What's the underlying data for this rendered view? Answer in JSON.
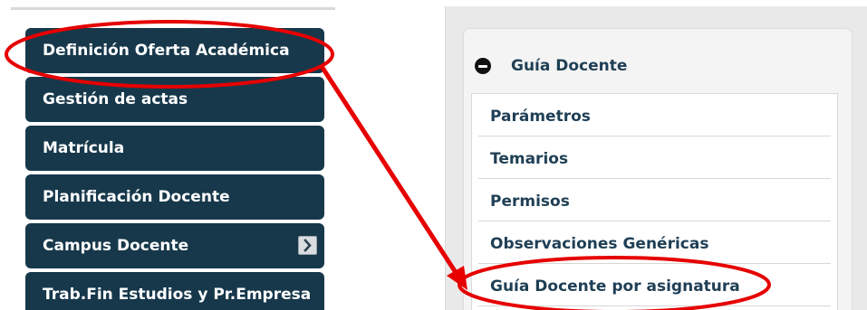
{
  "left_menu": {
    "items": [
      {
        "label": "Definición Oferta Académica"
      },
      {
        "label": "Gestión de actas"
      },
      {
        "label": "Matrícula"
      },
      {
        "label": "Planificación Docente"
      },
      {
        "label": "Campus Docente"
      },
      {
        "label": "Trab.Fin Estudios y Pr.Empresa"
      }
    ]
  },
  "right_panel": {
    "title": "Guía Docente",
    "items": [
      {
        "label": "Parámetros"
      },
      {
        "label": "Temarios"
      },
      {
        "label": "Permisos"
      },
      {
        "label": "Observaciones Genéricas"
      },
      {
        "label": "Guía Docente por asignatura"
      }
    ]
  },
  "colors": {
    "menu_background": "#17384b",
    "menu_text": "#ffffff",
    "panel_text": "#1f3f55",
    "annotation": "#e60000"
  },
  "icons": {
    "submenu_indicator": "chevron-right-icon",
    "collapse": "minus-circle-icon",
    "annotation_arrow": "arrow-icon"
  }
}
